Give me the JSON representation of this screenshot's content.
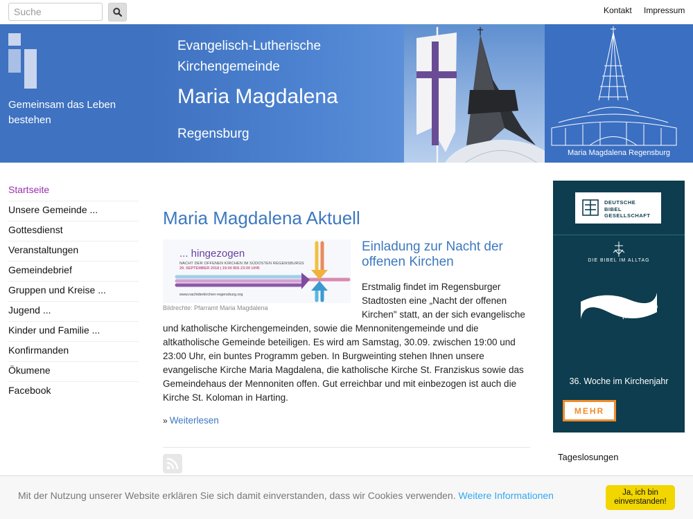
{
  "search": {
    "placeholder": "Suche"
  },
  "toplinks": {
    "contact": "Kontakt",
    "imprint": "Impressum"
  },
  "banner": {
    "tagline": "Gemeinsam das Leben bestehen",
    "line1": "Evangelisch-Lutherische",
    "line2": "Kirchengemeinde",
    "title": "Maria Magdalena",
    "city": "Regensburg",
    "caption": "Maria Magdalena Regensburg"
  },
  "nav": [
    {
      "label": "Startseite",
      "active": true
    },
    {
      "label": "Unsere Gemeinde ..."
    },
    {
      "label": "Gottesdienst"
    },
    {
      "label": "Veranstaltungen"
    },
    {
      "label": "Gemeindebrief"
    },
    {
      "label": "Gruppen und Kreise ..."
    },
    {
      "label": "Jugend ..."
    },
    {
      "label": "Kinder und Familie ..."
    },
    {
      "label": "Konfirmanden"
    },
    {
      "label": "Ökumene"
    },
    {
      "label": "Facebook"
    }
  ],
  "main": {
    "title": "Maria Magdalena Aktuell",
    "teaser": {
      "headline": "... hingezogen",
      "subline": "NACHT DER OFFENEN KIRCHEN IM SÜDOSTEN REGENSBURGS",
      "date": "29. SEPTEMBER 2018 | 19:00 BIS 23:00 UHR",
      "url": "www.nachtderkirchen-regensburg.org"
    },
    "img_credit": "Bildrechte: Pfarramt Maria Magdalena",
    "article_title": "Einladung zur Nacht der offenen Kirchen",
    "article_body": "Erstmalig findet im Regensburger Stadtosten eine „Nacht der offenen Kirchen\" statt, an der sich evangelische und katholische Kirchengemeinden, sowie die Mennonitengemeinde und die altkatholische Gemeinde beteiligen. Es wird am Samstag, 30.09. zwischen 19:00 und 23:00 Uhr, ein buntes Programm geben. In Burgweinting stehen Ihnen unsere evangelische Kirche Maria Magdalena, die katholische Kirche St. Franziskus sowie das Gemeindehaus der Mennoniten offen. Gut erreichbar und mit einbezogen ist auch die Kirche St. Koloman in Harting.",
    "read_more": "Weiterlesen"
  },
  "sidebar": {
    "logo_lines": [
      "DEUTSCHE",
      "BIBEL",
      "GESELLSCHAFT"
    ],
    "alltag": "DIE BIBEL IM ALLTAG",
    "wasserzeichen": "Wasserzeichen",
    "week": "36. Woche im Kirchenjahr",
    "more": "MEHR",
    "losungen": "Tageslosungen"
  },
  "cookie": {
    "text": "Mit der Nutzung unserer Website erklären Sie sich damit einverstanden, dass wir Cookies verwenden.",
    "link": "Weitere Informationen",
    "button": "Ja, ich bin einverstanden!"
  },
  "colors": {
    "brand_blue": "#3d78bf",
    "active_nav": "#9b2fae",
    "sidebar_bg": "#0d3d4e",
    "accent_orange": "#f08e2b",
    "cookie_button": "#f1d600"
  }
}
